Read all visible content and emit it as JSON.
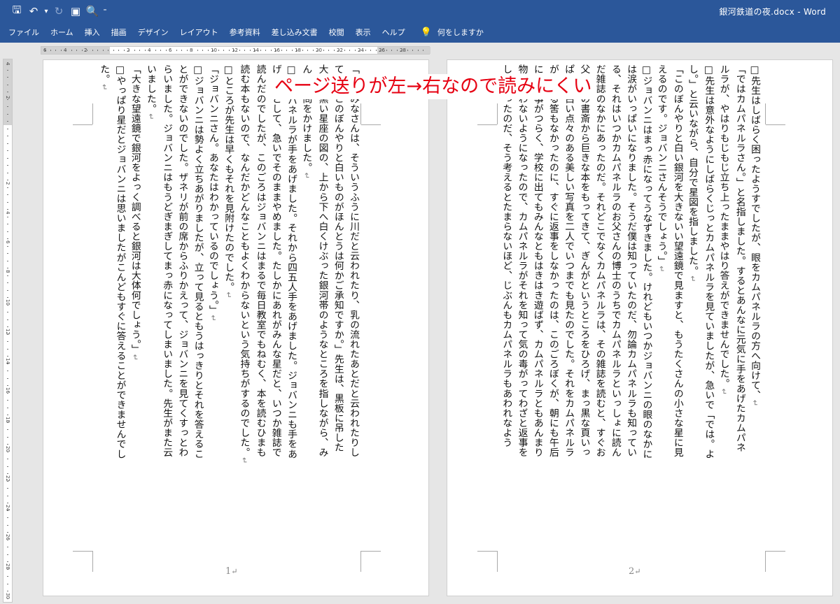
{
  "app": {
    "doc_title": "銀河鉄道の夜.docx  -  Word"
  },
  "qat": [
    {
      "icon": "save-icon",
      "glyph": "🖫",
      "dim": false
    },
    {
      "icon": "undo-icon",
      "glyph": "↶",
      "dim": false
    },
    {
      "icon": "undo-dropdown-icon",
      "glyph": "▾",
      "dim": false
    },
    {
      "icon": "redo-icon",
      "glyph": "↻",
      "dim": true
    },
    {
      "icon": "save-as-icon",
      "glyph": "▣",
      "dim": false
    },
    {
      "icon": "print-preview-icon",
      "glyph": "🔍",
      "dim": false
    },
    {
      "icon": "customize-qat-icon",
      "glyph": "⁼",
      "dim": false
    }
  ],
  "tabs": [
    "ファイル",
    "ホーム",
    "挿入",
    "描画",
    "デザイン",
    "レイアウト",
    "参考資料",
    "差し込み文書",
    "校閲",
    "表示",
    "ヘルプ"
  ],
  "tell_me": "何をしますか",
  "hruler_labels": [
    "6",
    "4",
    "2",
    "2",
    "4",
    "6",
    "8",
    "10",
    "12",
    "14",
    "16",
    "18",
    "20",
    "22",
    "24",
    "26",
    "28"
  ],
  "vruler_labels": [
    "4",
    "2",
    "2",
    "4",
    "6",
    "8",
    "10",
    "12",
    "14",
    "16",
    "18",
    "20",
    "22",
    "24",
    "26",
    "28",
    "30"
  ],
  "annotation": "ページ送りが左→右なので読みにくい",
  "pages": [
    {
      "page_number": "1",
      "columns": [
        {
          "text": "「ではみなさんは、そういうふうに川だと云われたり、乳の流れたあとだと云われたりし",
          "mark": false
        },
        {
          "text": "ていたこのぼんやりと白いものがほんとうは何かご承知ですか。」先生は、黒板に吊した",
          "mark": false
        },
        {
          "text": "大きな黒い星座の図の、上から下へ白くけぶった銀河帯のようなところを指しながら、み",
          "mark": false
        },
        {
          "text": "んなに問をかけました。",
          "mark": true
        },
        {
          "text": "□カムパネルラが手をあげました。それから四五人手をあげました。ジョバンニも手をあ",
          "mark": false
        },
        {
          "text": "げようとして、急いでそのままやめました。たしかにあれがみんな星だと、いつか雑誌で",
          "mark": false
        },
        {
          "text": "読んだのでしたが、このごろはジョバンニはまるで毎日教室でもねむく、本を読むひまも",
          "mark": false
        },
        {
          "text": "読む本もないので、なんだかどんなこともよくわからないという気持ちがするのでした。",
          "mark": true
        },
        {
          "text": "□ところが先生は早くもそれを見附けたのでした。",
          "mark": true
        },
        {
          "text": "「ジョバンニさん。あなたはわかっているのでしょう。」",
          "mark": true
        },
        {
          "text": "□ジョバンニは勢よく立ちあがりましたが、立って見るともうはっきりとそれを答えるこ",
          "mark": false
        },
        {
          "text": "とができないのでした。ザネリが前の席からふりかえって、ジョバンニを見てくすっとわ",
          "mark": false
        },
        {
          "text": "らいました。ジョバンニはもうどぎまぎしてまっ赤になってしまいました。先生がまた云",
          "mark": false
        },
        {
          "text": "いました。",
          "mark": true
        },
        {
          "text": "「大きな望遠鏡で銀河をよっく調べると銀河は大体何でしょう。」",
          "mark": true
        },
        {
          "text": "□やっぱり星だとジョバンニは思いましたがこんどもすぐに答えることができませんでし",
          "mark": false
        },
        {
          "text": "た。",
          "mark": true
        }
      ]
    },
    {
      "page_number": "2",
      "columns": [
        {
          "text": "□先生はしばらく困ったようすでしたが、眼をカムパネルラの方へ向けて、",
          "mark": true
        },
        {
          "text": "「ではカムパネルラさん。」と名指しました。するとあんなに元気に手をあげたカムパネ",
          "mark": false
        },
        {
          "text": "ルラが、やはりもじもじ立ち上ったままやはり答えができませんでした。",
          "mark": true
        },
        {
          "text": "□先生は意外なようにしばらくじっとカムパネルラを見ていましたが、急いで「では。よ",
          "mark": false
        },
        {
          "text": "し。」と云いながら、自分で星図を指しました。",
          "mark": true
        },
        {
          "text": "「このぼんやりと白い銀河を大きないい望遠鏡で見ますと、もうたくさんの小さな星に見",
          "mark": false
        },
        {
          "text": "えるのです。ジョバンニさんそうでしょう。」",
          "mark": true
        },
        {
          "text": "□ジョバンニはまっ赤になってうなずきました。けれどもいつかジョバンニの眼のなかに",
          "mark": false
        },
        {
          "text": "は涙がいっぱいになりました。そうだ僕は知っていたのだ、勿論カムパネルラも知ってい",
          "mark": false
        },
        {
          "text": "る、それはいつかカムパネルラのお父さんの博士のうちでカムパネルラといっしょに読ん",
          "mark": false
        },
        {
          "text": "だ雑誌のなかにあったのだ。それどこでなくカムパネルラは、その雑誌を読むと、すぐお",
          "mark": false
        },
        {
          "text": "父さんの書斎から巨きな本をもってきて、ぎんがというところをひろげ、まっ黒な頁いっ",
          "mark": false
        },
        {
          "text": "ぱいに白い点々のある美しい写真を二人でいつまでも見たのでした。それをカムパネルラ",
          "mark": false
        },
        {
          "text": "が忘れる筈もなかったのに、すぐに返事をしなかったのは、このごろぼくが、朝にも午后",
          "mark": false
        },
        {
          "text": "にも仕事がつらく、学校に出てもみんなともはきはき遊ばず、カムパネルラともあんまり",
          "mark": false
        },
        {
          "text": "物を云わないようになったので、カムパネルラがそれを知って気の毒がってわざと返事を",
          "mark": false
        },
        {
          "text": "しなかったのだ、そう考えるとたまらないほど、じぶんもカムパネルラもあわれなよう",
          "mark": false
        }
      ]
    }
  ]
}
